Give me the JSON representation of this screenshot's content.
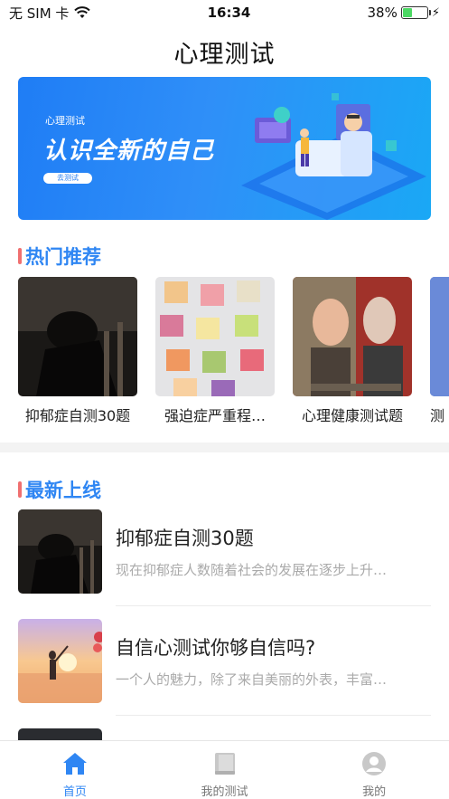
{
  "status_bar": {
    "carrier": "无 SIM 卡",
    "time": "16:34",
    "battery": "38%",
    "battery_level": 0.38
  },
  "nav": {
    "title": "心理测试"
  },
  "banner": {
    "subtitle": "心理测试",
    "headline": "认识全新的自己",
    "button": "去测试"
  },
  "hot": {
    "title": "热门推荐",
    "items": [
      {
        "label": "抑郁症自测30题"
      },
      {
        "label": "强迫症严重程…"
      },
      {
        "label": "心理健康测试题"
      },
      {
        "label": "测"
      }
    ]
  },
  "latest": {
    "title": "最新上线",
    "items": [
      {
        "title": "抑郁症自测30题",
        "desc": "现在抑郁症人数随着社会的发展在逐步上升…"
      },
      {
        "title": "自信心测试你够自信吗?",
        "desc": "一个人的魅力，除了来自美丽的外表，丰富…"
      }
    ]
  },
  "tabbar": {
    "tabs": [
      {
        "label": "首页",
        "icon": "home-icon",
        "active": true
      },
      {
        "label": "我的测试",
        "icon": "book-icon",
        "active": false
      },
      {
        "label": "我的",
        "icon": "user-icon",
        "active": false
      }
    ]
  },
  "colors": {
    "accent": "#2f86f3",
    "section_bar": "#f07070",
    "banner": "#2f8ff8"
  }
}
